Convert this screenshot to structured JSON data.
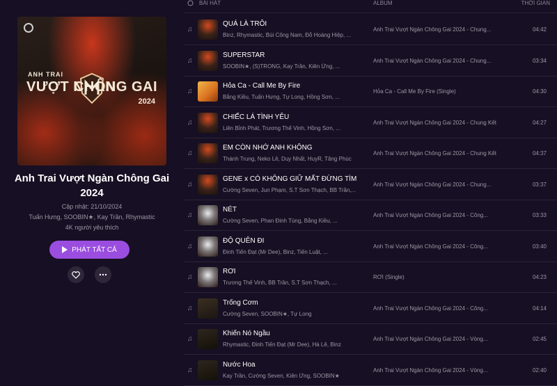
{
  "playlist": {
    "cover": {
      "pre_title": "ANH TRAI",
      "logo_left": "VƯỢT NGÀN",
      "logo_right": "CHÔNG GAI",
      "year": "2024"
    },
    "title": "Anh Trai Vượt Ngàn Chông Gai 2024",
    "updated": "Cập nhật: 21/10/2024",
    "artists": "Tuấn Hưng, SOOBIN★, Kay Trần, Rhymastic",
    "likes": "4K người yêu thích",
    "play_all_label": "PHÁT TẤT CẢ",
    "accent_color": "#9b4de0"
  },
  "list_header": {
    "song": "BÀI HÁT",
    "album": "ALBUM",
    "duration": "THỜI GIAN"
  },
  "songs": [
    {
      "title": "QUÁ LÀ TRÔI",
      "artists": "Binz, Rhymastic, Bùi Công Nam, Đỗ Hoàng Hiệp, ...",
      "album": "Anh Trai Vượt Ngàn Chông Gai 2024 - Chung...",
      "duration": "04:42",
      "thumb": "anh"
    },
    {
      "title": "SUPERSTAR",
      "artists": "SOOBIN★, (S)TRONG, Kay Trần, Kiên Ứng, ...",
      "album": "Anh Trai Vượt Ngàn Chông Gai 2024 - Chung...",
      "duration": "03:34",
      "thumb": "anh"
    },
    {
      "title": "Hỏa Ca - Call Me By Fire",
      "artists": "Bằng Kiều, Tuấn Hưng, Tự Long, Hồng Sơn, ...",
      "album": "Hỏa Ca - Call Me By Fire (Single)",
      "duration": "04:30",
      "thumb": "hoa"
    },
    {
      "title": "CHIẾC LÁ TÌNH YÊU",
      "artists": "Liên Bỉnh Phát, Trương Thế Vinh, Hồng Sơn, ...",
      "album": "Anh Trai Vượt Ngàn Chông Gai 2024 - Chung Kết",
      "duration": "04:27",
      "thumb": "anh"
    },
    {
      "title": "EM CÒN NHỚ ANH KHÔNG",
      "artists": "Thành Trung, Neko Lê, Duy Nhất, HuyR, Tăng Phúc",
      "album": "Anh Trai Vượt Ngàn Chông Gai 2024 - Chung Kết",
      "duration": "04:37",
      "thumb": "anh"
    },
    {
      "title": "GENE x CÓ KHÔNG GIỮ MẤT ĐỪNG TÌM",
      "artists": "Cường Seven, Jun Phạm, S.T Sơn Thạch, BB Trần,...",
      "album": "Anh Trai Vượt Ngàn Chông Gai 2024 - Chung...",
      "duration": "03:37",
      "thumb": "anh"
    },
    {
      "title": "NÉT",
      "artists": "Cường Seven, Phan Đinh Tùng, Bằng Kiều, ...",
      "album": "Anh Trai Vượt Ngàn Chông Gai 2024 - Công...",
      "duration": "03:33",
      "thumb": "net"
    },
    {
      "title": "ĐỘ QUÊN ĐI",
      "artists": "Đinh Tiến Đạt (Mr Dee), Binz, Tiến Luật, ...",
      "album": "Anh Trai Vượt Ngàn Chông Gai 2024 - Công...",
      "duration": "03:40",
      "thumb": "net"
    },
    {
      "title": "RƠI",
      "artists": "Trương Thế Vinh, BB Trần, S.T Sơn Thạch, ...",
      "album": "RƠI (Single)",
      "duration": "04:23",
      "thumb": "net"
    },
    {
      "title": "Trống Cơm",
      "artists": "Cường Seven, SOOBIN★, Tự Long",
      "album": "Anh Trai Vượt Ngàn Chông Gai 2024 - Công...",
      "duration": "04:14",
      "thumb": "trong"
    },
    {
      "title": "Khiến Nó Ngầu",
      "artists": "Rhymastic, Đinh Tiến Đạt (Mr Dee), Hà Lê, Binz",
      "album": "Anh Trai Vượt Ngàn Chông Gai 2024 - Vòng...",
      "duration": "02:45",
      "thumb": "concert"
    },
    {
      "title": "Nước Hoa",
      "artists": "Kay Trần, Cường Seven, Kiên Ứng, SOOBIN★",
      "album": "Anh Trai Vượt Ngàn Chông Gai 2024 - Vòng...",
      "duration": "02:40",
      "thumb": "concert"
    }
  ]
}
